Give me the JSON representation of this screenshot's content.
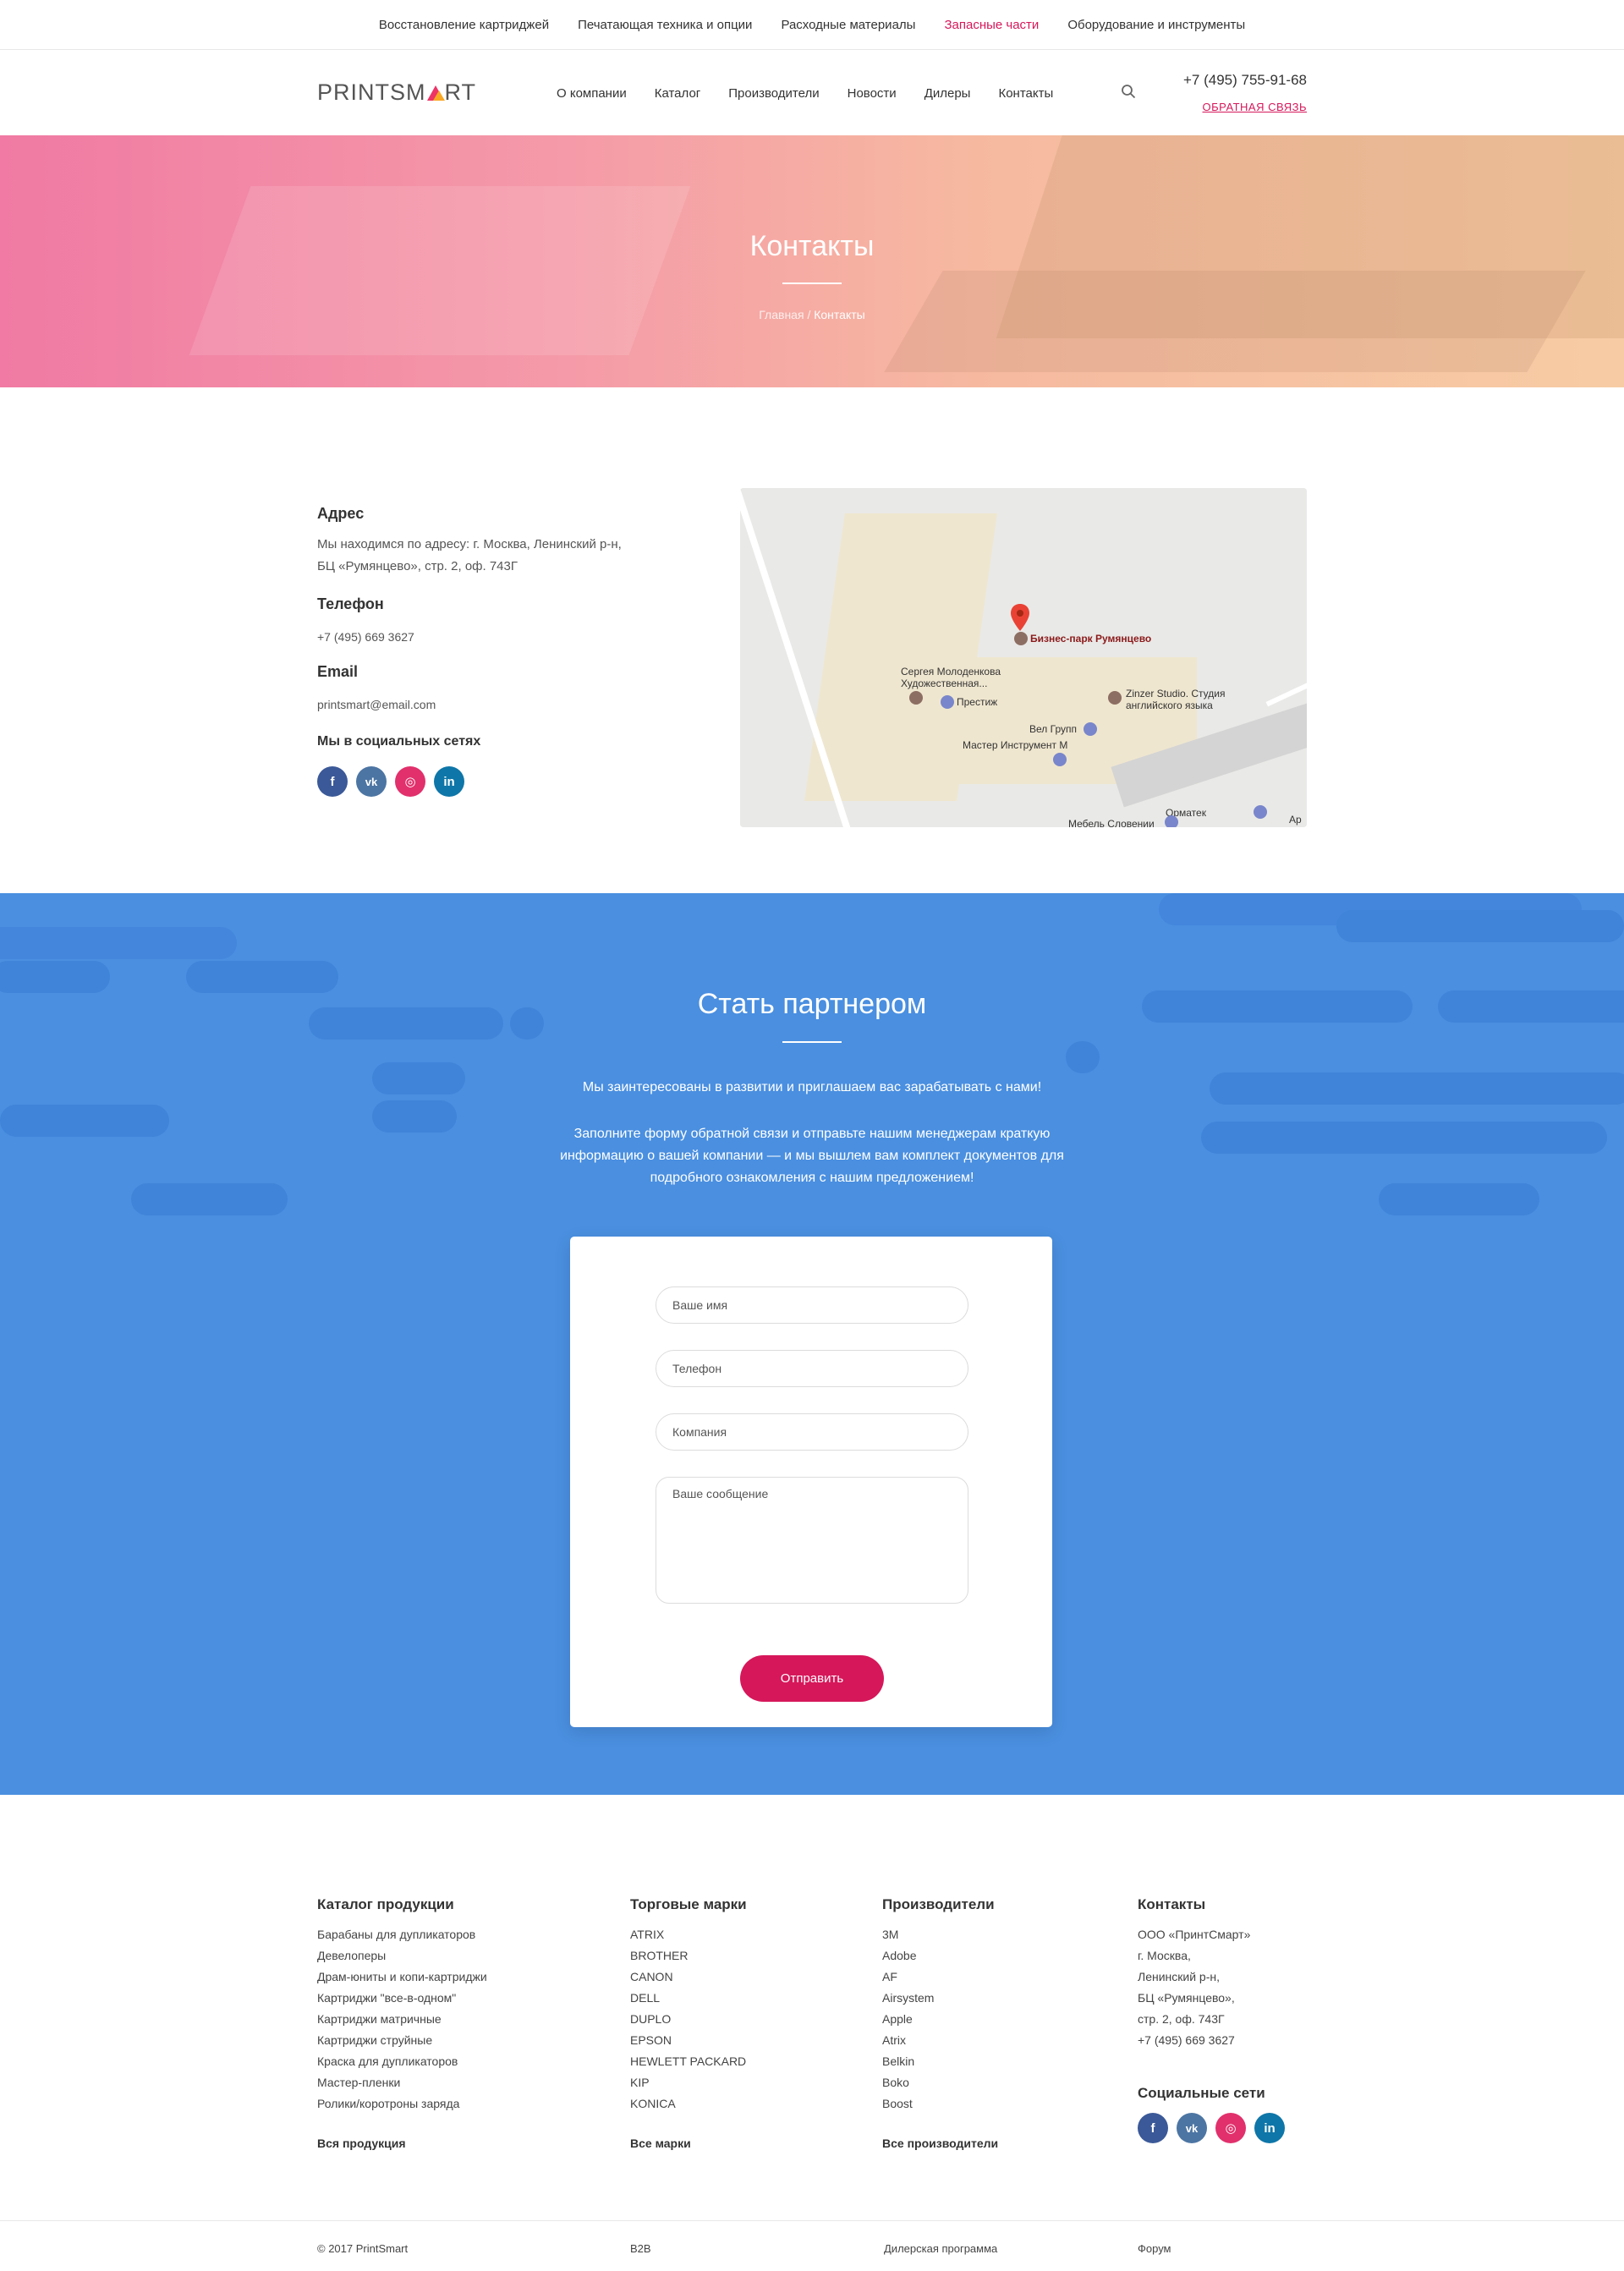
{
  "topbar": {
    "items": [
      "Восстановление картриджей",
      "Печатающая техника и опции",
      "Расходные материалы",
      "Запасные части",
      "Оборудование и инструменты"
    ],
    "active_index": 3
  },
  "header": {
    "logo_text_1": "PRINTSM",
    "logo_text_2": "RT",
    "nav": [
      "О компании",
      "Каталог",
      "Производители",
      "Новости",
      "Дилеры",
      "Контакты"
    ],
    "phone": "+7 (495) 755-91-68",
    "feedback": "Обратная связь"
  },
  "hero": {
    "title": "Контакты",
    "crumb_home": "Главная",
    "crumb_sep": " / ",
    "crumb_current": "Контакты"
  },
  "contacts": {
    "address_title": "Адрес",
    "address_line1": "Мы находимся по адресу:  г. Москва, Ленинский р-н,",
    "address_line2": "БЦ «Румянцево», стр. 2, оф. 743Г",
    "phone_title": "Телефон",
    "phone": "+7 (495) 669 3627",
    "email_title": "Email",
    "email": "printsmart@email.com",
    "social_title": "Мы в социальных сетях",
    "social": [
      {
        "icon": "facebook-icon",
        "glyph": "f",
        "color": "#3b5998"
      },
      {
        "icon": "vk-icon",
        "glyph": "vk",
        "color": "#4c75a3"
      },
      {
        "icon": "instagram-icon",
        "glyph": "◎",
        "color": "#e1306c"
      },
      {
        "icon": "linkedin-icon",
        "glyph": "in",
        "color": "#0e76a8"
      }
    ]
  },
  "map": {
    "labels": {
      "biz": "Бизнес-парк Румянцево",
      "sergey_1": "Сергея Молоденкова",
      "sergey_2": "Художественная...",
      "prestige": "Престиж",
      "zinzer_1": "Zinzer Studio. Студия",
      "zinzer_2": "английского языка",
      "vel": "Вел Групп",
      "master": "Мастер Инструмент М",
      "ormatek": "Орматек",
      "mebel": "Мебель Словении",
      "ara": "Ар"
    }
  },
  "partner": {
    "title": "Стать партнером",
    "p1": "Мы заинтересованы в развитии и приглашаем вас зарабатывать с нами!",
    "p2": "Заполните форму обратной связи и отправьте нашим менеджерам краткую информацию о вашей компании — и мы вышлем вам комплект документов для подробного ознакомления с нашим предложением!",
    "fields": {
      "name": "Ваше имя",
      "phone": "Телефон",
      "company": "Компания",
      "message": "Ваше сообщение"
    },
    "submit": "Отправить"
  },
  "footer": {
    "catalog": {
      "title": "Каталог продукции",
      "items": [
        "Барабаны для дупликаторов",
        "Девелоперы",
        "Драм-юниты и копи-картриджи",
        "Картриджи \"все-в-одном\"",
        "Картриджи матричные",
        "Картриджи струйные",
        "Краска для дупликаторов",
        "Мастер-пленки",
        "Ролики/коротроны заряда"
      ],
      "all": "Вся продукция"
    },
    "brands": {
      "title": "Торговые марки",
      "items": [
        "ATRIX",
        "BROTHER",
        "CANON",
        "DELL",
        "DUPLO",
        "EPSON",
        "HEWLETT PACKARD",
        "KIP",
        "KONICA"
      ],
      "all": "Все марки"
    },
    "makers": {
      "title": "Производители",
      "items": [
        "3M",
        "Adobe",
        "AF",
        "Airsystem",
        "Apple",
        "Atrix",
        "Belkin",
        "Boko",
        "Boost"
      ],
      "all": "Все производители"
    },
    "contacts": {
      "title": "Контакты",
      "lines": [
        "ООО «ПринтСмарт»",
        "г. Москва,",
        "Ленинский р-н,",
        "БЦ «Румянцево»,",
        "стр. 2, оф. 743Г",
        "+7 (495) 669 3627"
      ],
      "social_title": "Социальные сети"
    },
    "bottom": {
      "copyright": "© 2017 PrintSmart",
      "b2b": "B2B",
      "dealer": "Дилерская программа",
      "forum": "Форум"
    }
  }
}
